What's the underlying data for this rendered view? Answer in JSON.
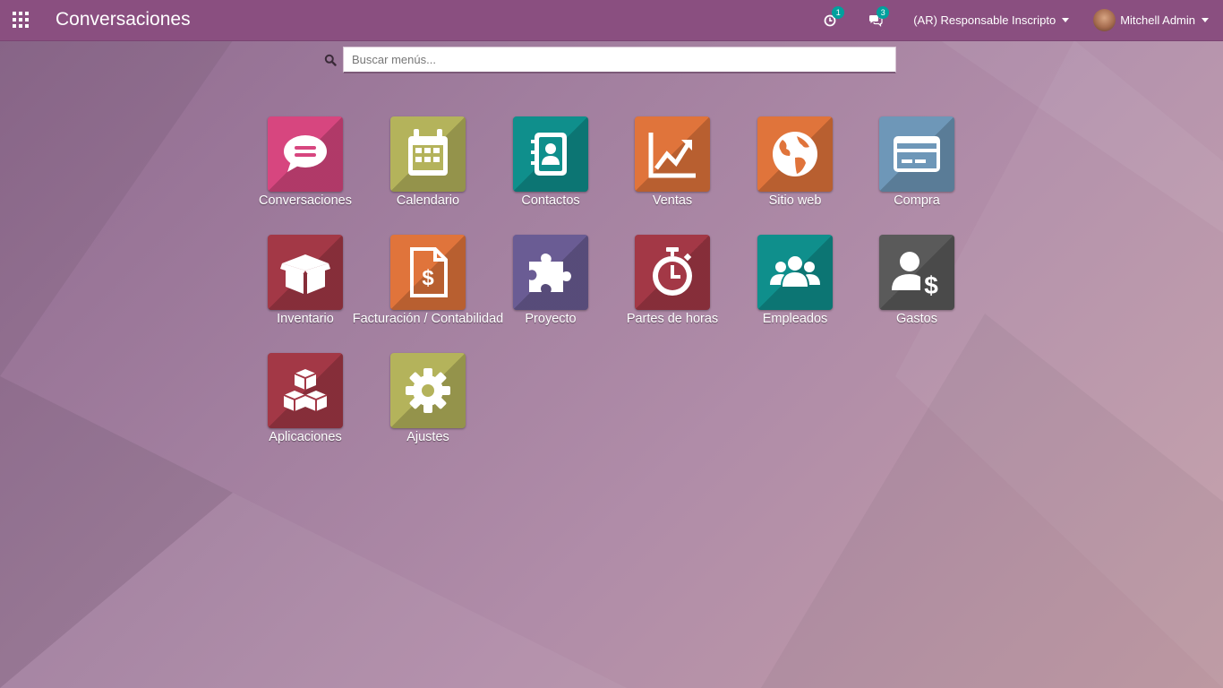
{
  "header": {
    "title": "Conversaciones",
    "activity_count": "1",
    "messages_count": "3",
    "company": "(AR) Responsable Inscripto",
    "user": "Mitchell Admin"
  },
  "search": {
    "placeholder": "Buscar menús..."
  },
  "apps": [
    {
      "label": "Conversaciones",
      "icon": "chat-icon",
      "color": "#d7467f"
    },
    {
      "label": "Calendario",
      "icon": "calendar-icon",
      "color": "#b4b35b"
    },
    {
      "label": "Contactos",
      "icon": "address-book-icon",
      "color": "#0f8f8c"
    },
    {
      "label": "Ventas",
      "icon": "chart-trend-icon",
      "color": "#e0743b"
    },
    {
      "label": "Sitio web",
      "icon": "globe-icon",
      "color": "#e0743b"
    },
    {
      "label": "Compra",
      "icon": "credit-card-icon",
      "color": "#6e97b8"
    },
    {
      "label": "Inventario",
      "icon": "box-icon",
      "color": "#a33846"
    },
    {
      "label": "Facturación / Contabilidad",
      "icon": "invoice-icon",
      "color": "#e0743b"
    },
    {
      "label": "Proyecto",
      "icon": "puzzle-icon",
      "color": "#6a5c94"
    },
    {
      "label": "Partes de horas",
      "icon": "stopwatch-icon",
      "color": "#a33846"
    },
    {
      "label": "Empleados",
      "icon": "users-icon",
      "color": "#0f8f8c"
    },
    {
      "label": "Gastos",
      "icon": "user-dollar-icon",
      "color": "#5a5a5a"
    },
    {
      "label": "Aplicaciones",
      "icon": "cubes-icon",
      "color": "#a33846"
    },
    {
      "label": "Ajustes",
      "icon": "gear-icon",
      "color": "#b4b35b"
    }
  ]
}
